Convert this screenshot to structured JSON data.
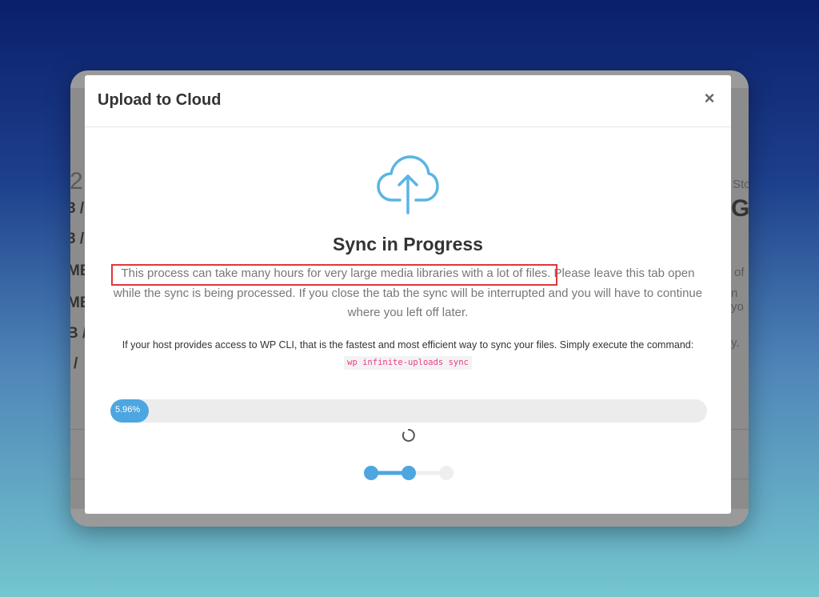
{
  "modal": {
    "title": "Upload to Cloud",
    "close_symbol": "×",
    "heading": "Sync in Progress",
    "description": "This process can take many hours for very large media libraries with a lot of files. Please leave this tab open while the sync is being processed. If you close the tab the sync will be interrupted and you will have to continue where you left off later.",
    "cli_text": "If your host provides access to WP CLI, that is the fastest and most efficient way to sync your files. Simply execute the command:",
    "cli_command": "wp infinite-uploads sync",
    "progress": {
      "percent": 5.96,
      "label": "5.96%"
    },
    "steps": {
      "total": 3,
      "active": 2
    }
  },
  "icons": {
    "cloud": "cloud-upload-icon",
    "spinner": "loading-spinner-icon",
    "close": "close-icon"
  },
  "colors": {
    "accent": "#4da6e0",
    "cloud_icon": "#5bb4e3",
    "highlight_border": "#e0363d",
    "code_text": "#e83e8c"
  },
  "background_page": {
    "left_fragments": [
      "2",
      "3 /",
      "3 /",
      "MB",
      "MB",
      "B /",
      "/"
    ],
    "right_fragments": [
      "Sto",
      "GB",
      "of",
      "n yo",
      "y."
    ]
  }
}
